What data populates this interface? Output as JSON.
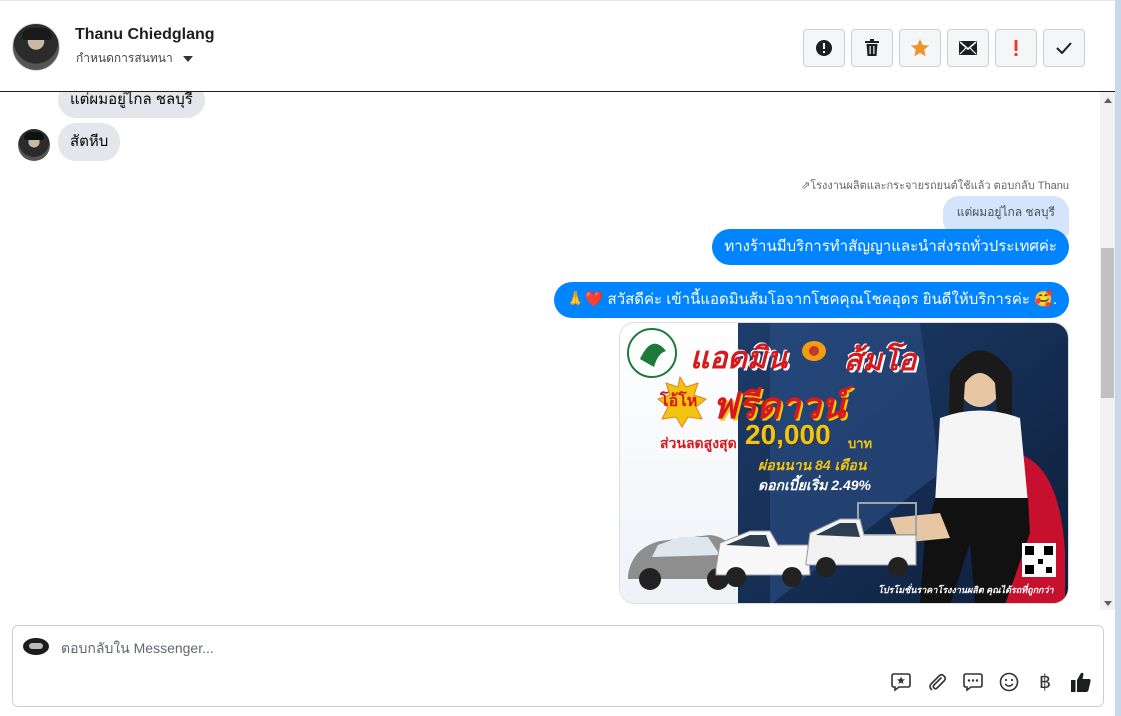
{
  "header": {
    "contact_name": "Thanu Chiedglang",
    "assign_label": "กำหนดการสนทนา"
  },
  "actions": [
    {
      "name": "spam-button",
      "icon": "alert-circle-icon"
    },
    {
      "name": "delete-button",
      "icon": "trash-icon"
    },
    {
      "name": "star-button",
      "icon": "star-icon",
      "color": "#f0932b"
    },
    {
      "name": "mark-unread-button",
      "icon": "envelope-icon"
    },
    {
      "name": "follow-up-button",
      "icon": "exclamation-icon",
      "color": "#e44332"
    },
    {
      "name": "done-button",
      "icon": "check-icon"
    }
  ],
  "messages": {
    "incoming_1": "แต่ผมอยู่ไกล ชลบุรี",
    "incoming_2": "สัตหีบ",
    "reply_meta": "โรงงานผลิตและกระจายรถยนต์ใช้แล้ว ตอบกลับ Thanu",
    "quoted": "แต่ผมอยู่ไกล ชลบุรี",
    "outgoing_1": "ทางร้านมีบริการทำสัญญาและนำส่งรถทั่วประเทศค่ะ",
    "outgoing_2": "🙏❤️ สวัสดีค่ะ เข้านี้แอดมินส้มโอจากโชคคุณโชคอุดร ยินดีให้บริการค่ะ 🥰."
  },
  "promo": {
    "title_left": "แอดมิน",
    "title_right": "ส้มโอ",
    "badge": "โอ้โห",
    "headline": "ฟรีดาวน์",
    "discount_label": "ส่วนลดสูงสุด",
    "discount_value": "20,000",
    "discount_unit": "บาท",
    "installment": "ผ่อนนาน 84 เดือน",
    "interest": "ดอกเบี้ยเริ่ม 2.49%",
    "footer": "โปรโมชั่นราคาโรงงานผลิต คุณได้รถที่ถูกกว่า"
  },
  "composer": {
    "placeholder": "ตอบกลับใน Messenger..."
  },
  "colors": {
    "outgoing_bubble": "#0084ff",
    "incoming_bubble": "#e4e6eb",
    "quoted_bubble": "#d4e4fb"
  }
}
